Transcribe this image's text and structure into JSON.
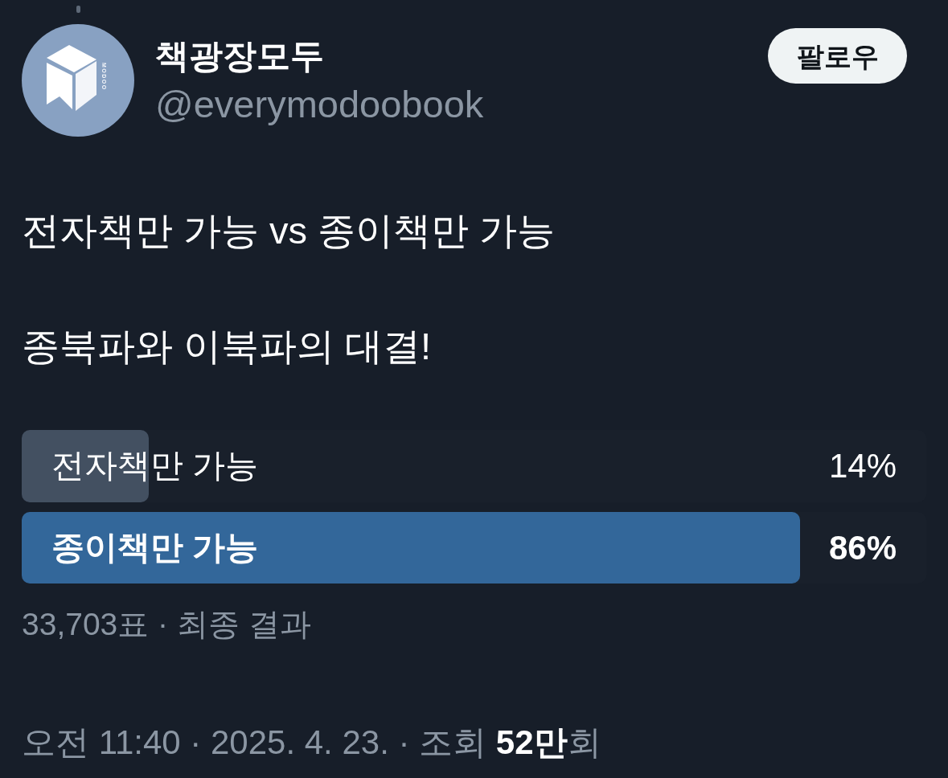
{
  "author": {
    "name": "책광장모두",
    "handle": "@everymodoobook",
    "avatar": {
      "logo_text": "MODOO"
    }
  },
  "follow_button": {
    "label": "팔로우"
  },
  "post": {
    "text": "전자책만 가능 vs 종이책만 가능\n\n종북파와 이북파의 대결!"
  },
  "poll": {
    "options": [
      {
        "label": "전자책만 가능",
        "percent": "14%",
        "level": 0.14,
        "winner": false
      },
      {
        "label": "종이책만 가능",
        "percent": "86%",
        "level": 0.86,
        "winner": true
      }
    ],
    "summary": "33,703표 · 최종 결과"
  },
  "meta": {
    "text": "오전 11:40 · 2025. 4. 23. · 조회 **52만**회"
  }
}
